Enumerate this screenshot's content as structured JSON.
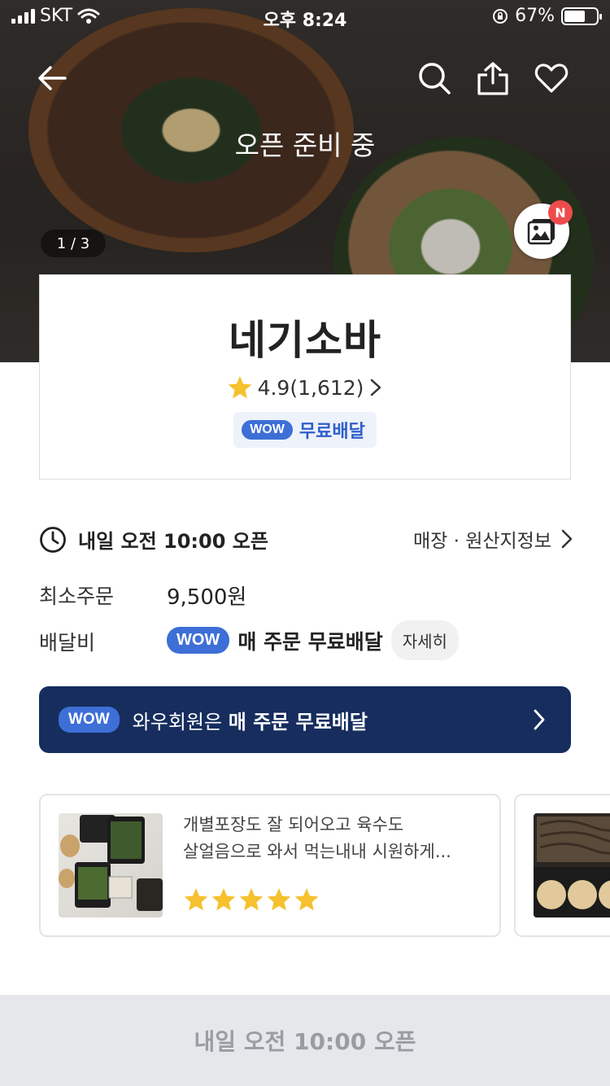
{
  "status_bar": {
    "carrier": "SKT",
    "time": "오후 8:24",
    "battery": "67%",
    "battery_level": 0.67
  },
  "hero": {
    "prep_status": "오픈 준비 중",
    "photo_counter": "1 / 3",
    "gallery_badge": "N"
  },
  "store": {
    "name": "네기소바",
    "rating": "4.9(1,612)",
    "wow_label": "WOW",
    "free_delivery": "무료배달"
  },
  "info": {
    "hours": "내일 오전 10:00 오픈",
    "store_info_link": "매장 · 원산지정보",
    "min_order_label": "최소주문",
    "min_order_value": "9,500원",
    "delivery_fee_label": "배달비",
    "delivery_fee_wow": "WOW",
    "delivery_fee_text": "매 주문 무료배달",
    "detail_button": "자세히"
  },
  "banner": {
    "wow": "WOW",
    "text_prefix": "와우회원은 ",
    "text_bold": "매 주문 무료배달"
  },
  "reviews": [
    {
      "line1": "개별포장도 잘 되어오고 육수도",
      "line2": "살얼음으로 와서 먹는내내 시원하게...",
      "stars": 5
    }
  ],
  "bottom_button": "내일 오전 10:00 오픈",
  "colors": {
    "wow_blue": "#3d6fd6",
    "banner_navy": "#162d5e",
    "star": "#f5c12e",
    "badge_red": "#ee4c4c"
  },
  "icons": [
    "back-arrow-icon",
    "search-icon",
    "share-icon",
    "heart-icon",
    "gallery-icon",
    "star-icon",
    "clock-icon",
    "chevron-right-icon",
    "wifi-icon",
    "lock-rotation-icon"
  ]
}
